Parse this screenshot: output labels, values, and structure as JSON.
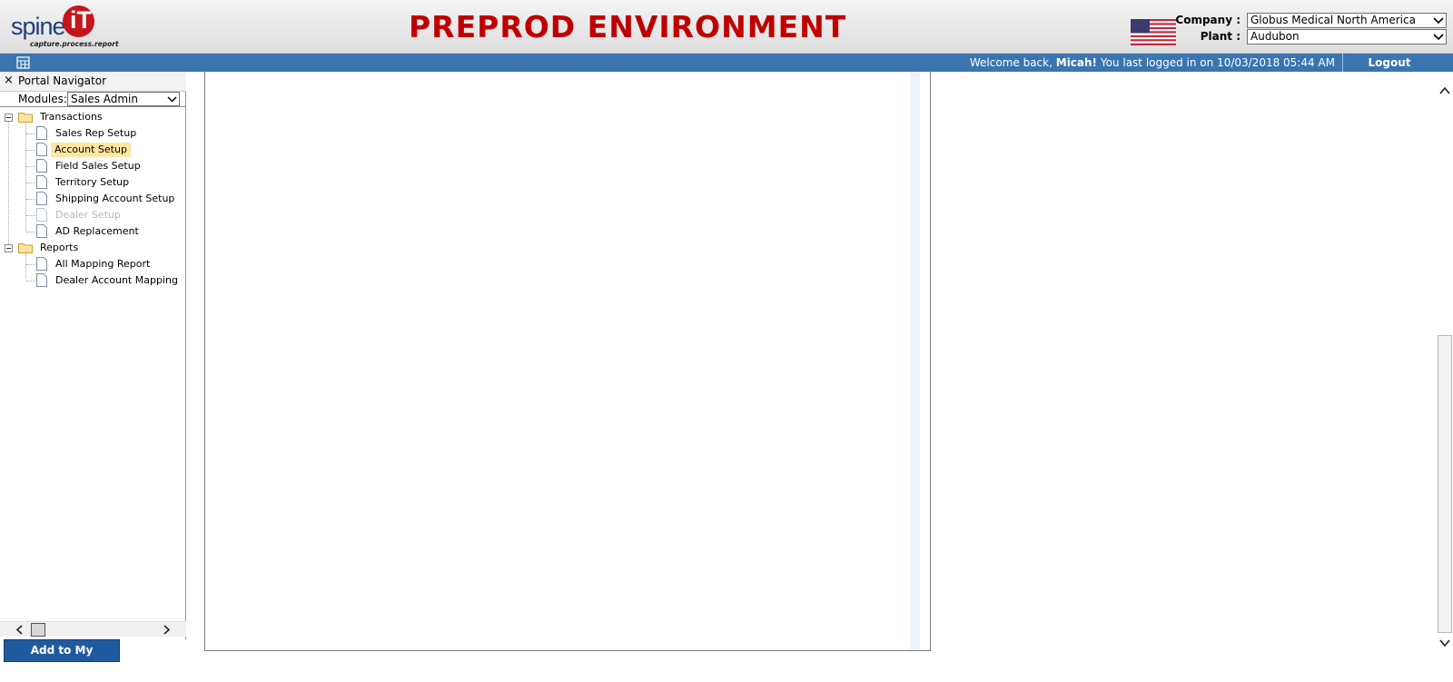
{
  "logo": {
    "word": "spine",
    "mark": "iT",
    "tagline": "capture.process.report"
  },
  "environment_title": "PREPROD ENVIRONMENT",
  "header": {
    "flag_icon": "us-flag-icon",
    "company_label": "Company :",
    "company_value": "Globus Medical North America",
    "plant_label": "Plant :",
    "plant_value": "Audubon"
  },
  "topbar": {
    "welcome_prefix": "Welcome back,",
    "user_name": "Micah!",
    "welcome_suffix": "You last logged in on 10/03/2018 05:44 AM",
    "logout_label": "Logout"
  },
  "navigator": {
    "close_glyph": "×",
    "title": "Portal Navigator",
    "modules_label": "Modules:",
    "modules_value": "Sales Admin",
    "tree": [
      {
        "label": "Transactions",
        "children": [
          {
            "label": "Sales Rep Setup",
            "selected": false,
            "disabled": false
          },
          {
            "label": "Account Setup",
            "selected": true,
            "disabled": false
          },
          {
            "label": "Field Sales Setup",
            "selected": false,
            "disabled": false
          },
          {
            "label": "Territory Setup",
            "selected": false,
            "disabled": false
          },
          {
            "label": "Shipping Account Setup",
            "selected": false,
            "disabled": false
          },
          {
            "label": "Dealer Setup",
            "selected": false,
            "disabled": true
          },
          {
            "label": "AD Replacement",
            "selected": false,
            "disabled": false
          }
        ]
      },
      {
        "label": "Reports",
        "children": [
          {
            "label": "All Mapping Report",
            "selected": false,
            "disabled": false
          },
          {
            "label": "Dealer Account Mapping",
            "selected": false,
            "disabled": false
          }
        ]
      }
    ]
  },
  "favorites_button": "Add to My Favorites",
  "colors": {
    "brand_red": "#c00000",
    "bar_blue": "#3a75b0",
    "favorites_blue": "#1f5aa0",
    "selected_highlight": "#ffe7a3"
  }
}
